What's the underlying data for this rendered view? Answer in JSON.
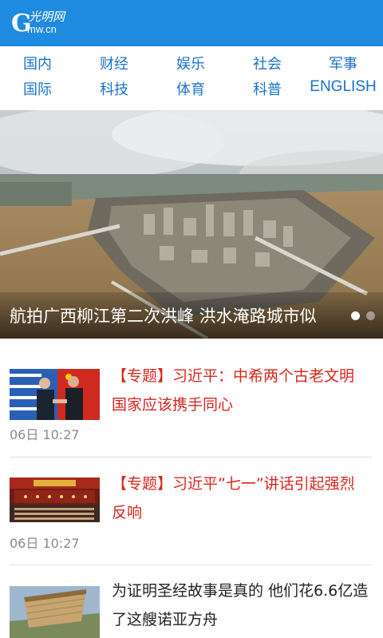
{
  "header": {
    "logo_text": "光明网",
    "logo_sub": "Gmw.cn",
    "brand_color": "#1e8ae0"
  },
  "nav": {
    "row1": [
      "国内",
      "财经",
      "娱乐",
      "社会",
      "军事"
    ],
    "row2": [
      "国际",
      "科技",
      "体育",
      "科普",
      "ENGLISH"
    ],
    "link_color": "#1a73c9"
  },
  "hero": {
    "title": "航拍广西柳江第二次洪峰 洪水淹路城市似",
    "slide_count": 2,
    "active_slide": 1
  },
  "news": [
    {
      "title": "【专题】习近平：中希两个古老文明国家应该携手同心",
      "time": "06日 10:27",
      "highlight": true,
      "thumb_icon": "leaders-handshake-photo"
    },
    {
      "title": "【专题】习近平”七一”讲话引起强烈反响",
      "time": "06日 10:27",
      "highlight": true,
      "thumb_icon": "assembly-hall-photo"
    },
    {
      "title": "为证明圣经故事是真的 他们花6.6亿造了这艘诺亚方舟",
      "time": "",
      "highlight": false,
      "thumb_icon": "ark-ship-photo"
    }
  ],
  "colors": {
    "highlight_red": "#d9251d",
    "time_gray": "#8a8a8a"
  }
}
